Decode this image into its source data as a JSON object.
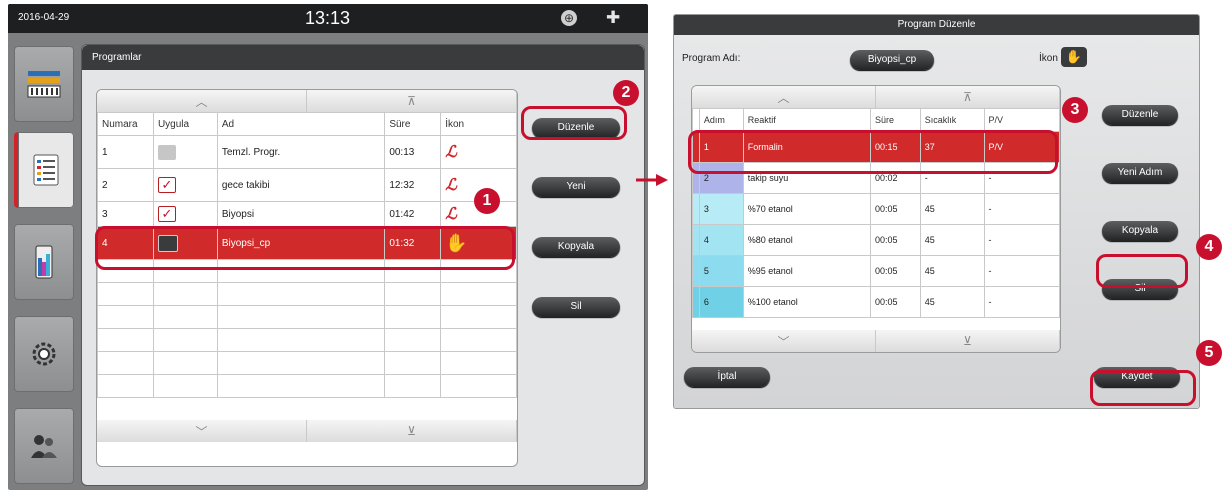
{
  "left": {
    "topbar": {
      "date": "2016-04-29",
      "time": "13:13"
    },
    "panel_title": "Programlar",
    "columns": [
      "Numara",
      "Uygula",
      "Ad",
      "Süre",
      "İkon"
    ],
    "rows": [
      {
        "num": "1",
        "apply": "unchecked",
        "name": "Temzl. Progr.",
        "time": "00:13",
        "icon": "reagent-icon"
      },
      {
        "num": "2",
        "apply": "checked",
        "name": "gece takibi",
        "time": "12:32",
        "icon": "reagent-icon"
      },
      {
        "num": "3",
        "apply": "checked",
        "name": "Biyopsi",
        "time": "01:42",
        "icon": "reagent-icon"
      },
      {
        "num": "4",
        "apply": "unchecked",
        "name": "Biyopsi_cp",
        "time": "01:32",
        "icon": "hand-icon",
        "selected": true
      }
    ],
    "buttons": {
      "edit": "Düzenle",
      "new": "Yeni",
      "copy": "Kopyala",
      "delete": "Sil"
    }
  },
  "right": {
    "title": "Program Düzenle",
    "program_name_label": "Program Adı:",
    "program_name_value": "Biyopsi_cp",
    "icon_label": "İkon",
    "columns": [
      "Adım",
      "Reaktif",
      "Süre",
      "Sıcaklık",
      "P/V"
    ],
    "rows": [
      {
        "step": "1",
        "reagent": "Formalin",
        "time": "00:15",
        "temp": "37",
        "pv": "P/V",
        "color": "#d12a2a",
        "selected": true
      },
      {
        "step": "2",
        "reagent": "takip suyu",
        "time": "00:02",
        "temp": "-",
        "pv": "-",
        "color": "#aeb4ea"
      },
      {
        "step": "3",
        "reagent": "%70 etanol",
        "time": "00:05",
        "temp": "45",
        "pv": "-",
        "color": "#b7ecf6"
      },
      {
        "step": "4",
        "reagent": "%80 etanol",
        "time": "00:05",
        "temp": "45",
        "pv": "-",
        "color": "#a3e4f3"
      },
      {
        "step": "5",
        "reagent": "%95 etanol",
        "time": "00:05",
        "temp": "45",
        "pv": "-",
        "color": "#8ddbee"
      },
      {
        "step": "6",
        "reagent": "%100 etanol",
        "time": "00:05",
        "temp": "45",
        "pv": "-",
        "color": "#6fd0e6"
      }
    ],
    "buttons": {
      "edit": "Düzenle",
      "new_step": "Yeni Adım",
      "copy": "Kopyala",
      "delete": "Sil",
      "cancel": "İptal",
      "save": "Kaydet"
    }
  },
  "badges": [
    "1",
    "2",
    "3",
    "4",
    "5"
  ],
  "colors": {
    "accent_red": "#c8102e",
    "selected_row": "#d12a2a"
  }
}
